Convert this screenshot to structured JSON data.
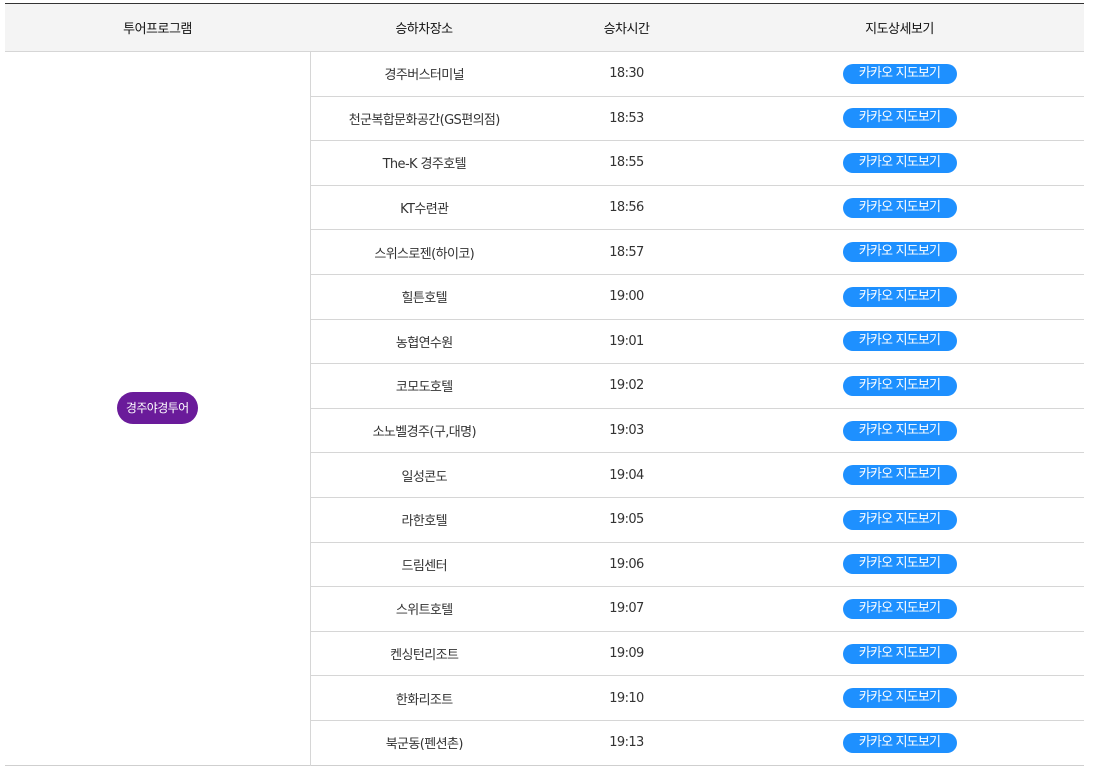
{
  "table": {
    "headers": [
      "투어프로그램",
      "승하차장소",
      "승차시간",
      "지도상세보기"
    ],
    "program": "경주야경투어",
    "map_button_label": "카카오 지도보기",
    "stops": [
      {
        "place": "경주버스터미널",
        "time": "18:30"
      },
      {
        "place": "천군복합문화공간(GS편의점)",
        "time": "18:53"
      },
      {
        "place": "The-K 경주호텔",
        "time": "18:55"
      },
      {
        "place": "KT수련관",
        "time": "18:56"
      },
      {
        "place": "스위스로젠(하이코)",
        "time": "18:57"
      },
      {
        "place": "힐튼호텔",
        "time": "19:00"
      },
      {
        "place": "농협연수원",
        "time": "19:01"
      },
      {
        "place": "코모도호텔",
        "time": "19:02"
      },
      {
        "place": "소노벨경주(구,대명)",
        "time": "19:03"
      },
      {
        "place": "일성콘도",
        "time": "19:04"
      },
      {
        "place": "라한호텔",
        "time": "19:05"
      },
      {
        "place": "드림센터",
        "time": "19:06"
      },
      {
        "place": "스위트호텔",
        "time": "19:07"
      },
      {
        "place": "켄싱턴리조트",
        "time": "19:09"
      },
      {
        "place": "한화리조트",
        "time": "19:10"
      },
      {
        "place": "북군동(펜션촌)",
        "time": "19:13"
      }
    ]
  },
  "colors": {
    "badge_bg": "#6a1b9a",
    "button_bg": "#1e90ff",
    "header_bg": "#f4f4f4"
  }
}
